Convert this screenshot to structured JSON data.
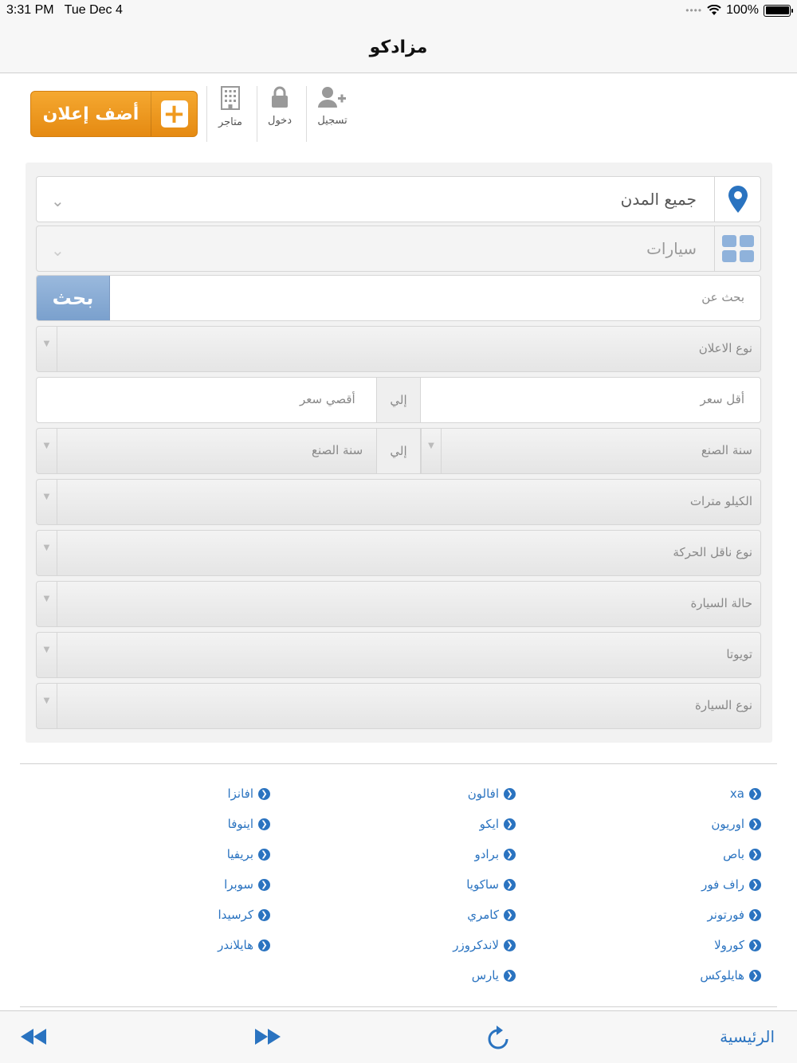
{
  "status_bar": {
    "time": "3:31 PM",
    "date": "Tue Dec 4",
    "battery": "100%",
    "battery_level": 1.0
  },
  "nav": {
    "title": "مزادكو"
  },
  "toolbar": {
    "add_ad_label": "أضف إعلان",
    "stores_label": "متاجر",
    "login_label": "دخول",
    "register_label": "تسجيل"
  },
  "search": {
    "city": "جميع المدن",
    "category": "سيارات",
    "search_placeholder": "بحث عن",
    "search_button": "بحث",
    "ad_type": "نوع الاعلان",
    "min_price": "أقل سعر",
    "max_price": "أقصي سعر",
    "to_label": "إلي",
    "year_from": "سنة الصنع",
    "year_to": "سنة الصنع",
    "kilometers": "الكيلو مترات",
    "transmission": "نوع ناقل الحركة",
    "condition": "حالة السيارة",
    "brand": "تويوتا",
    "car_type": "نوع السيارة"
  },
  "models": {
    "col_right": [
      "xa",
      "اوريون",
      "باص",
      "راف فور",
      "فورتونر",
      "كورولا",
      "هايلوكس"
    ],
    "col_middle": [
      "افالون",
      "ايكو",
      "برادو",
      "ساكويا",
      "كامري",
      "لاندكروزر",
      "يارس"
    ],
    "col_left": [
      "افانزا",
      "اينوفا",
      "بريفيا",
      "سوبرا",
      "كرسيدا",
      "هايلاندر"
    ]
  },
  "bottom_bar": {
    "home_label": "الرئيسية"
  }
}
